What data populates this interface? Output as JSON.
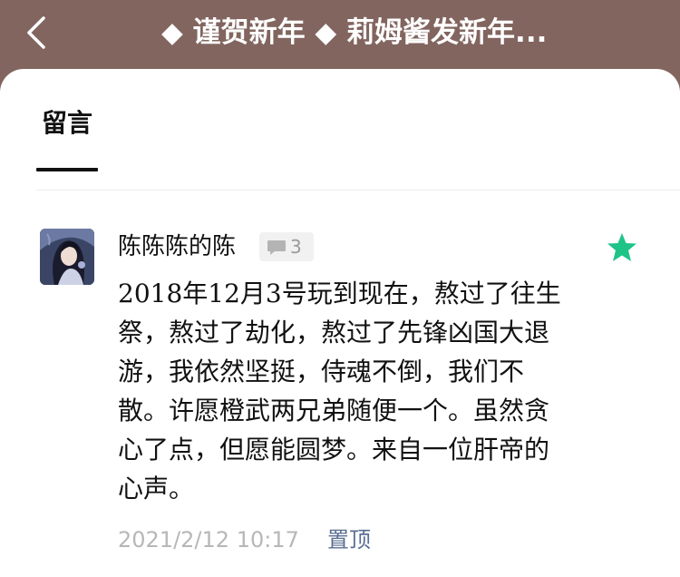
{
  "header": {
    "title": "◆ 谨贺新年 ◆ 莉姆酱发新年...",
    "back_icon": "chevron-left-icon",
    "background_color": "#82655f"
  },
  "tabs": [
    {
      "label": "留言",
      "active": true
    }
  ],
  "comments": [
    {
      "username": "陈陈陈的陈",
      "reply_count": "3",
      "text": "2018年12月3号玩到现在，熬过了往生祭，熬过了劫化，熬过了先锋凶国大退游，我依然坚挺，侍魂不倒，我们不散。许愿橙武两兄弟随便一个。虽然贪心了点，但愿能圆梦。来自一位肝帝的心声。",
      "timestamp": "2021/2/12 10:17",
      "pin_label": "置顶",
      "starred": true,
      "star_color": "#1ec487",
      "pin_color": "#5b6f93"
    }
  ]
}
